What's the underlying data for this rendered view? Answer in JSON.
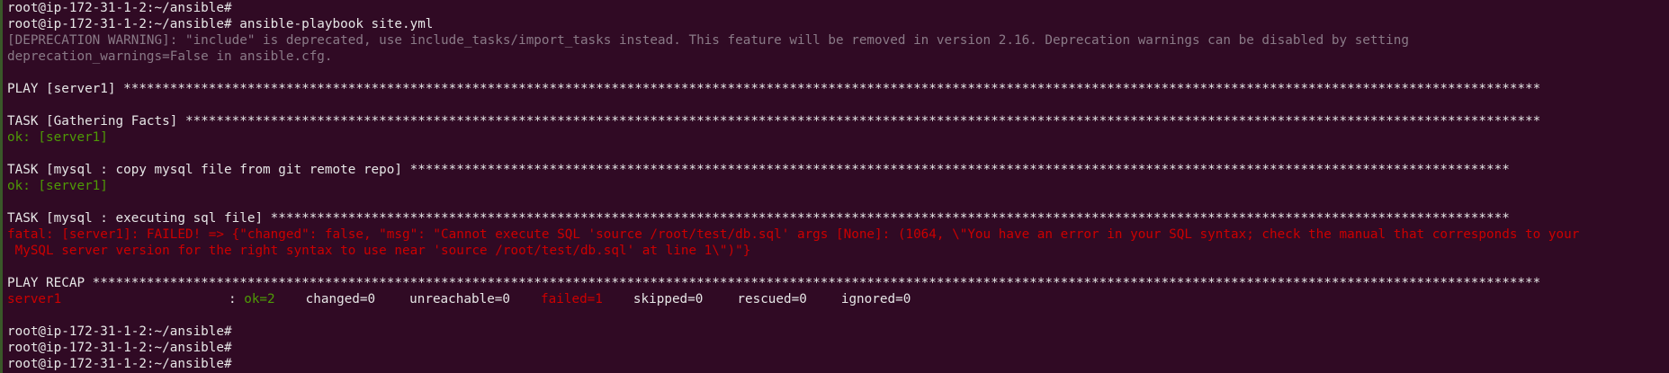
{
  "terminal": {
    "lines": [
      {
        "kind": "prompt",
        "text": "root@ip-172-31-1-2:~/ansible#"
      },
      {
        "kind": "prompt",
        "text": "root@ip-172-31-1-2:~/ansible# ansible-playbook site.yml"
      },
      {
        "kind": "warning",
        "text": "[DEPRECATION WARNING]: \"include\" is deprecated, use include_tasks/import_tasks instead. This feature will be removed in version 2.16. Deprecation warnings can be disabled by setting"
      },
      {
        "kind": "warning",
        "text": "deprecation_warnings=False in ansible.cfg."
      },
      {
        "kind": "blank",
        "text": ""
      },
      {
        "kind": "header",
        "text": "PLAY [server1] ***************************************************************************************************************************************************************************************"
      },
      {
        "kind": "blank",
        "text": ""
      },
      {
        "kind": "header",
        "text": "TASK [Gathering Facts] *******************************************************************************************************************************************************************************"
      },
      {
        "kind": "ok",
        "text": "ok: [server1]"
      },
      {
        "kind": "blank",
        "text": ""
      },
      {
        "kind": "header",
        "text": "TASK [mysql : copy mysql file from git remote repo] **********************************************************************************************************************************************"
      },
      {
        "kind": "ok",
        "text": "ok: [server1]"
      },
      {
        "kind": "blank",
        "text": ""
      },
      {
        "kind": "header",
        "text": "TASK [mysql : executing sql file] ****************************************************************************************************************************************************************"
      },
      {
        "kind": "fatal",
        "text": "fatal: [server1]: FAILED! => {\"changed\": false, \"msg\": \"Cannot execute SQL 'source /root/test/db.sql' args [None]: (1064, \\\"You have an error in your SQL syntax; check the manual that corresponds to your"
      },
      {
        "kind": "fatal",
        "text": " MySQL server version for the right syntax to use near 'source /root/test/db.sql' at line 1\\\")\"}"
      },
      {
        "kind": "blank",
        "text": ""
      },
      {
        "kind": "header",
        "text": "PLAY RECAP *******************************************************************************************************************************************************************************************"
      }
    ],
    "recap": {
      "host": "server1",
      "separator": ": ",
      "ok": "ok=2",
      "changed": "changed=0",
      "unreachable": "unreachable=0",
      "failed": "failed=1",
      "skipped": "skipped=0",
      "rescued": "rescued=0",
      "ignored": "ignored=0"
    },
    "trailing_prompts": [
      "root@ip-172-31-1-2:~/ansible#",
      "root@ip-172-31-1-2:~/ansible#",
      "root@ip-172-31-1-2:~/ansible#"
    ],
    "colors": {
      "background": "#300a24",
      "foreground": "#e6e6e6",
      "warning": "#8a7a87",
      "ok": "#4e9a06",
      "fatal": "#cc0000"
    }
  }
}
